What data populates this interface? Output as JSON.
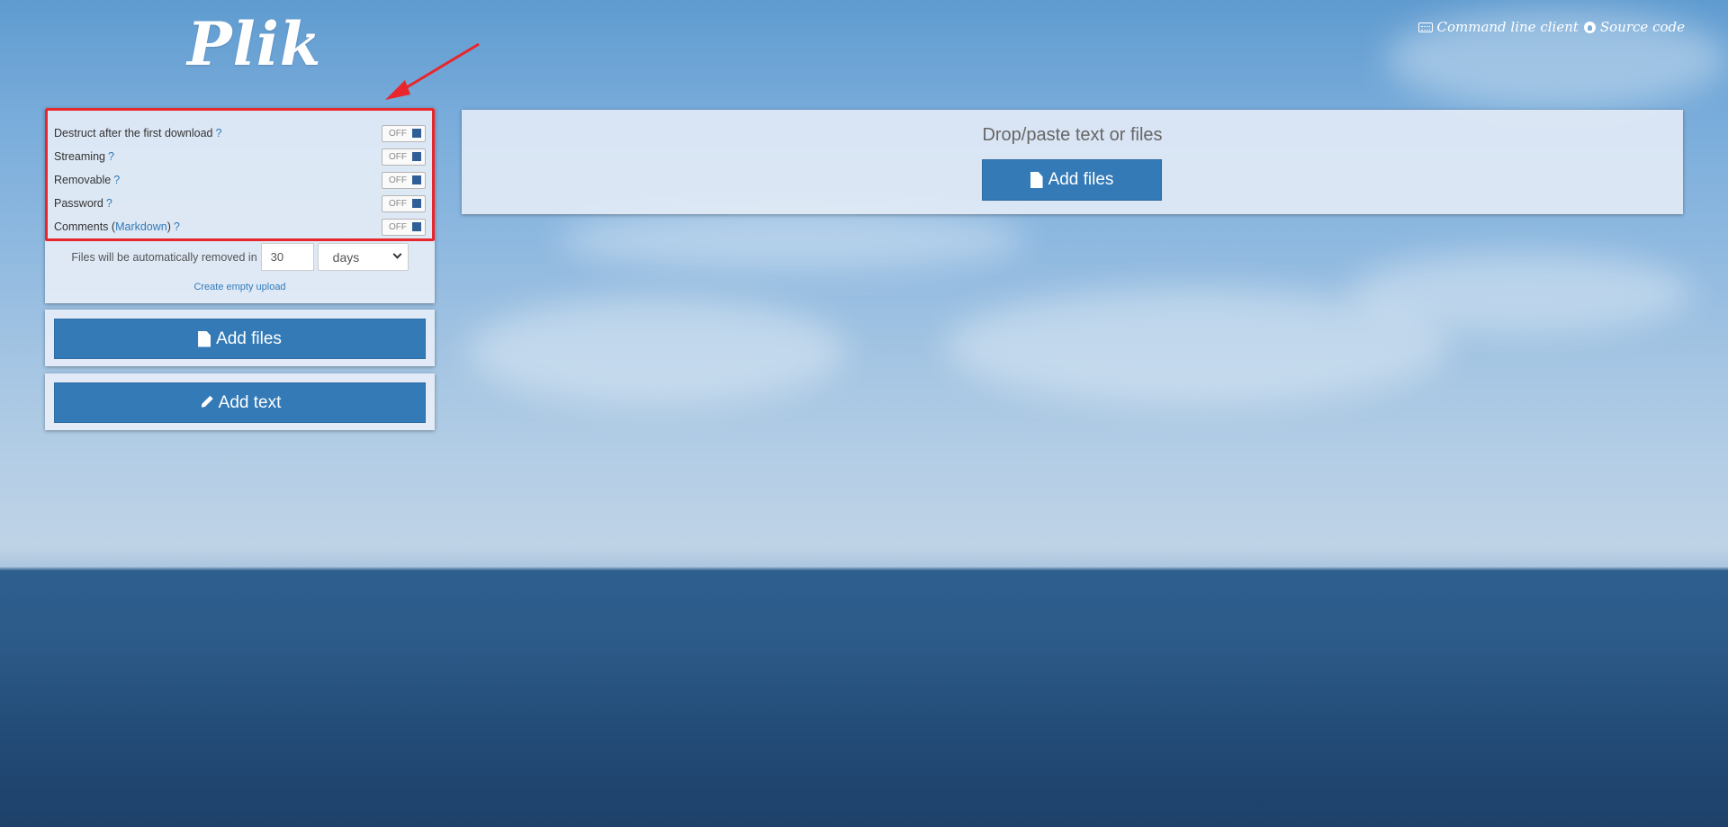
{
  "brand": {
    "title": "Plik"
  },
  "top_links": {
    "cli_label": "Command line client",
    "source_label": "Source code"
  },
  "settings": {
    "options": [
      {
        "label": "Destruct after the first download",
        "help": "?",
        "state": "OFF"
      },
      {
        "label": "Streaming",
        "help": "?",
        "state": "OFF"
      },
      {
        "label": "Removable",
        "help": "?",
        "state": "OFF"
      },
      {
        "label": "Password",
        "help": "?",
        "state": "OFF"
      },
      {
        "label": "Comments (",
        "link": "Markdown",
        "label_after": ")",
        "help": "?",
        "state": "OFF"
      }
    ],
    "expiry": {
      "prefix": "Files will be automatically removed in",
      "value": "30",
      "unit": "days"
    },
    "empty_upload_label": "Create empty upload"
  },
  "sidebar": {
    "add_files_label": "Add files",
    "add_text_label": "Add text"
  },
  "dropzone": {
    "title": "Drop/paste text or files",
    "add_files_label": "Add files"
  },
  "colors": {
    "accent": "#337ab7",
    "annotation": "#e8262b",
    "toggle_knob": "#2f5f96"
  }
}
